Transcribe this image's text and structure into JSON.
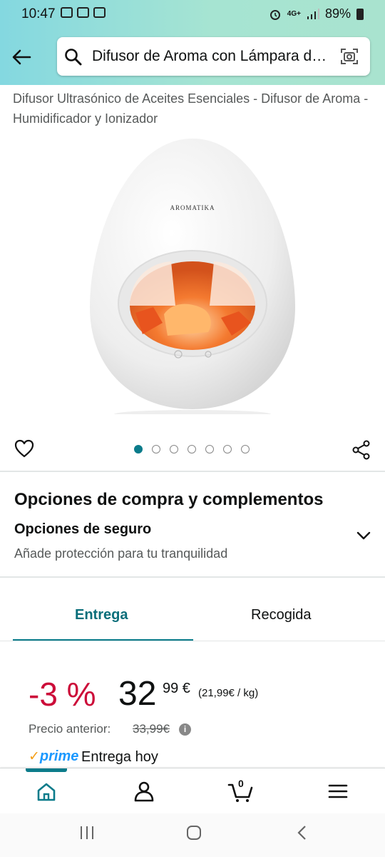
{
  "status_bar": {
    "time": "10:47",
    "network": "4G+",
    "battery": "89%",
    "icons": [
      "m-notification-icon",
      "gallery-notification-icon",
      "cast-notification-icon",
      "alarm-icon",
      "signal-icon",
      "battery-icon"
    ]
  },
  "header": {
    "search_text": "Difusor de Aroma con Lámpara de Sal",
    "icons": [
      "back-arrow-icon",
      "search-icon",
      "camera-search-icon"
    ]
  },
  "product": {
    "title": "Difusor Ultrasónico de Aceites Esenciales - Difusor de Aroma - Humidificador y Ionizador",
    "brand_on_device": "AROMATIKA",
    "image_count": 7,
    "active_image": 1
  },
  "purchase_options": {
    "heading": "Opciones de compra y complementos",
    "insurance_title": "Opciones de seguro",
    "insurance_subtitle": "Añade protección para tu tranquilidad"
  },
  "tabs": [
    {
      "label": "Entrega",
      "active": true
    },
    {
      "label": "Recogida",
      "active": false
    }
  ],
  "pricing": {
    "discount": "-3 %",
    "price_whole": "32",
    "price_fraction": "99 €",
    "unit_price": "(21,99€ / kg)",
    "previous_label": "Precio anterior:",
    "previous_value": "33,99€"
  },
  "delivery": {
    "prime_check": "✓",
    "prime_label": "prime",
    "text": "Entrega hoy"
  },
  "bottom_nav": {
    "cart_count": "0",
    "items": [
      "home-icon",
      "account-icon",
      "cart-icon",
      "menu-icon"
    ]
  },
  "colors": {
    "accent": "#0a7b8a",
    "discount": "#cc0c39",
    "prime_blue": "#1a98ff",
    "prime_check": "#f49e17",
    "header_gradient_start": "#84d8e0",
    "header_gradient_end": "#a9e3cf"
  }
}
